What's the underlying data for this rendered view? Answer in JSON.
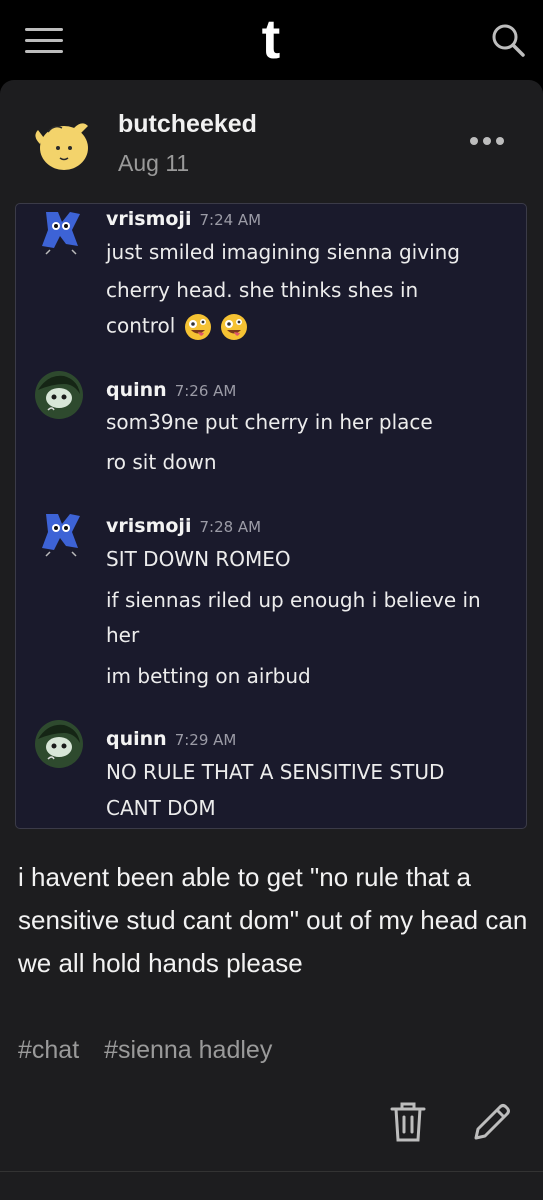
{
  "header": {
    "logo": "t",
    "menu_icon": "hamburger-icon",
    "search_icon": "search-icon"
  },
  "post": {
    "author": "butcheeked",
    "date": "Aug 11",
    "chat": [
      {
        "name": "vrismoji",
        "time": "7:24 AM",
        "lines": [
          "just smiled imagining sienna giving",
          "cherry head. she thinks shes in",
          "control"
        ],
        "emoji_count": 2
      },
      {
        "name": "quinn",
        "time": "7:26 AM",
        "lines": [
          "som39ne put cherry in her place",
          "ro sit down"
        ]
      },
      {
        "name": "vrismoji",
        "time": "7:28 AM",
        "lines": [
          "SIT DOWN ROMEO",
          "if siennas riled up enough i believe in",
          "her",
          "im betting on airbud"
        ]
      },
      {
        "name": "quinn",
        "time": "7:29 AM",
        "lines": [
          "NO RULE THAT A SENSITIVE STUD",
          "CANT DOM"
        ]
      }
    ],
    "body": "i havent been able to get \"no rule that a sensitive stud cant dom\" out of my head can we all hold hands please",
    "tags": [
      "#chat",
      "#sienna hadley"
    ]
  },
  "colors": {
    "background": "#000000",
    "card": "#1d1d1f",
    "chat_bg": "#1a1a2c",
    "muted": "#9a9a9a"
  }
}
